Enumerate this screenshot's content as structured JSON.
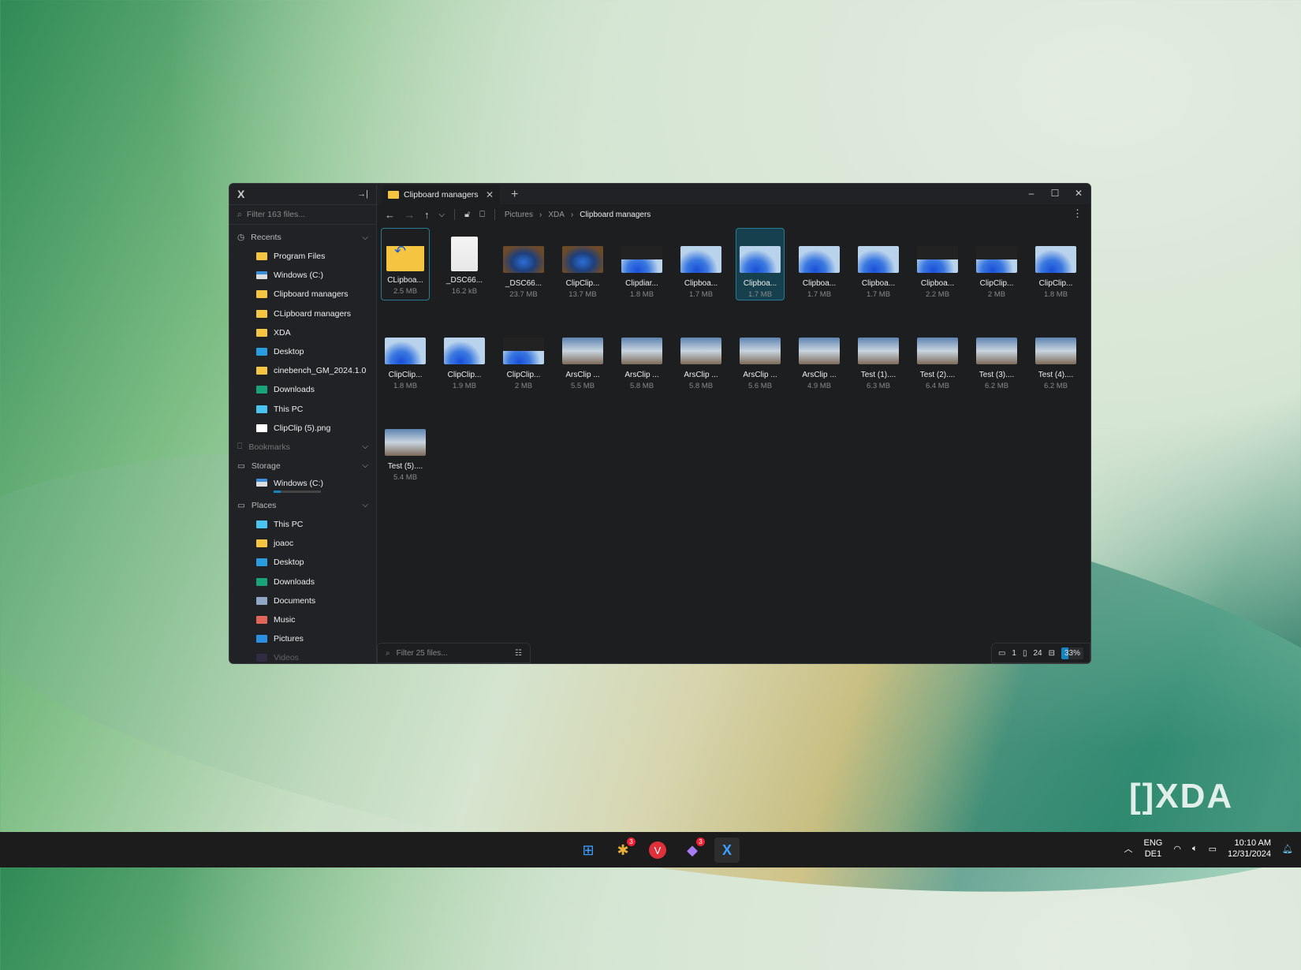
{
  "window": {
    "app_logo": "X",
    "collapse_icon": "→|",
    "tab_label": "Clipboard managers",
    "new_tab": "+",
    "minimize": "–",
    "maximize": "☐",
    "close": "✕"
  },
  "sidebar": {
    "filter_placeholder": "Filter 163 files...",
    "recents_label": "Recents",
    "recents": [
      {
        "label": "Program Files",
        "icon": "folder"
      },
      {
        "label": "Windows (C:)",
        "icon": "drive"
      },
      {
        "label": "Clipboard managers",
        "icon": "folder"
      },
      {
        "label": "CLipboard managers",
        "icon": "folder"
      },
      {
        "label": "XDA",
        "icon": "folder"
      },
      {
        "label": "Desktop",
        "icon": "desktop"
      },
      {
        "label": "cinebench_GM_2024.1.0",
        "icon": "folder"
      },
      {
        "label": "Downloads",
        "icon": "downloads"
      },
      {
        "label": "This PC",
        "icon": "pc"
      },
      {
        "label": "ClipClip (5).png",
        "icon": "image"
      }
    ],
    "bookmarks_label": "Bookmarks",
    "storage_label": "Storage",
    "storage": [
      {
        "label": "Windows (C:)",
        "used_fraction": 0.15
      }
    ],
    "places_label": "Places",
    "places": [
      {
        "label": "This PC",
        "icon": "pc"
      },
      {
        "label": "joaoc",
        "icon": "folder"
      },
      {
        "label": "Desktop",
        "icon": "desktop"
      },
      {
        "label": "Downloads",
        "icon": "downloads"
      },
      {
        "label": "Documents",
        "icon": "documents"
      },
      {
        "label": "Music",
        "icon": "music"
      },
      {
        "label": "Pictures",
        "icon": "pictures"
      },
      {
        "label": "Videos",
        "icon": "videos"
      }
    ]
  },
  "toolbar": {
    "breadcrumb": [
      "Pictures",
      "XDA",
      "Clipboard managers"
    ]
  },
  "files": [
    {
      "name": "CLipboa...",
      "size": "2.5 MB",
      "thumb": "folder",
      "state": "focus"
    },
    {
      "name": "_DSC66...",
      "size": "16.2 kB",
      "thumb": "doc"
    },
    {
      "name": "_DSC66...",
      "size": "23.7 MB",
      "thumb": "photo"
    },
    {
      "name": "ClipClip...",
      "size": "13.7 MB",
      "thumb": "photo"
    },
    {
      "name": "Clipdiar...",
      "size": "1.8 MB",
      "thumb": "win11dark"
    },
    {
      "name": "Clipboa...",
      "size": "1.7 MB",
      "thumb": "win11"
    },
    {
      "name": "Clipboa...",
      "size": "1.7 MB",
      "thumb": "win11",
      "state": "selected"
    },
    {
      "name": "Clipboa...",
      "size": "1.7 MB",
      "thumb": "win11"
    },
    {
      "name": "Clipboa...",
      "size": "1.7 MB",
      "thumb": "win11"
    },
    {
      "name": "Clipboa...",
      "size": "2.2 MB",
      "thumb": "win11dark"
    },
    {
      "name": "ClipClip...",
      "size": "2 MB",
      "thumb": "win11dark"
    },
    {
      "name": "ClipClip...",
      "size": "1.8 MB",
      "thumb": "win11"
    },
    {
      "name": "ClipClip...",
      "size": "1.8 MB",
      "thumb": "win11"
    },
    {
      "name": "ClipClip...",
      "size": "1.9 MB",
      "thumb": "win11"
    },
    {
      "name": "ClipClip...",
      "size": "2 MB",
      "thumb": "win11dark"
    },
    {
      "name": "ArsClip ...",
      "size": "5.5 MB",
      "thumb": "coaster"
    },
    {
      "name": "ArsClip ...",
      "size": "5.8 MB",
      "thumb": "coaster"
    },
    {
      "name": "ArsClip ...",
      "size": "5.8 MB",
      "thumb": "coaster"
    },
    {
      "name": "ArsClip ...",
      "size": "5.6 MB",
      "thumb": "coaster"
    },
    {
      "name": "ArsClip ...",
      "size": "4.9 MB",
      "thumb": "coaster"
    },
    {
      "name": "Test (1)....",
      "size": "6.3 MB",
      "thumb": "coaster"
    },
    {
      "name": "Test (2)....",
      "size": "6.4 MB",
      "thumb": "coaster"
    },
    {
      "name": "Test (3)....",
      "size": "6.2 MB",
      "thumb": "coaster"
    },
    {
      "name": "Test (4)....",
      "size": "6.2 MB",
      "thumb": "coaster"
    },
    {
      "name": "Test (5)....",
      "size": "5.4 MB",
      "thumb": "coaster"
    }
  ],
  "statusbar": {
    "filter_placeholder": "Filter 25 files...",
    "folder_count": "1",
    "file_count": "24",
    "zoom": "33%"
  },
  "taskbar": {
    "apps": [
      {
        "name": "start",
        "badge": ""
      },
      {
        "name": "slack",
        "badge": "3"
      },
      {
        "name": "vivaldi",
        "badge": ""
      },
      {
        "name": "teams",
        "badge": "3"
      },
      {
        "name": "files",
        "badge": ""
      }
    ],
    "lang1": "ENG",
    "lang2": "DE1",
    "time": "10:10 AM",
    "date": "12/31/2024"
  },
  "watermark": "XDA",
  "colors": {
    "accent": "#1784c0",
    "selection": "#16404e",
    "folder": "#f5c542"
  }
}
